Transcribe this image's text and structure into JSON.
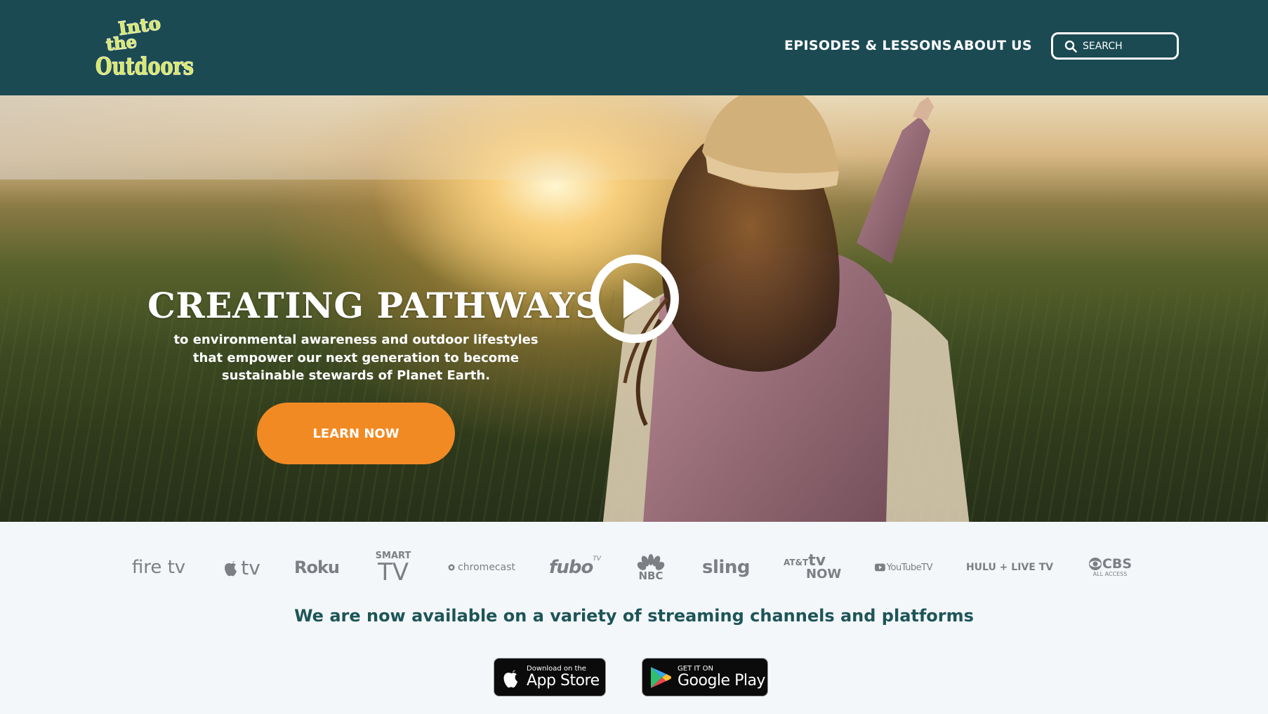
{
  "header": {
    "logo_text": [
      "Into",
      "the",
      "Outdoors"
    ],
    "nav": [
      {
        "label": "EPISODES & LESSONS"
      },
      {
        "label": "ABOUT US"
      }
    ],
    "search": {
      "placeholder": "SEARCH",
      "icon": "search-icon"
    }
  },
  "hero": {
    "title": "CREATING PATHWAYS",
    "subtitle": "to environmental awareness and outdoor lifestyles that empower our next generation to become sustainable stewards of Planet Earth.",
    "cta_label": "LEARN NOW",
    "play_icon": "play-icon"
  },
  "platforms": {
    "logos": [
      {
        "name": "fire tv",
        "text": "fire tv"
      },
      {
        "name": "apple tv",
        "text": "tv"
      },
      {
        "name": "roku",
        "text": "Roku"
      },
      {
        "name": "smart tv",
        "text_top": "SMART",
        "text_bottom": "TV"
      },
      {
        "name": "chromecast",
        "text": "chromecast"
      },
      {
        "name": "fubo",
        "text": "fubo",
        "sup": "TV"
      },
      {
        "name": "nbc",
        "text": "NBC"
      },
      {
        "name": "sling",
        "text": "sling"
      },
      {
        "name": "att tv now",
        "text_top": "AT&T",
        "text_tv": "tv",
        "text_bottom": "NOW"
      },
      {
        "name": "youtube tv",
        "text": "YouTubeTV"
      },
      {
        "name": "hulu live tv",
        "text": "HULU + LIVE TV"
      },
      {
        "name": "cbs all access",
        "text_top": "CBS",
        "text_bottom": "ALL ACCESS"
      }
    ],
    "headline": "We are now available on a variety of streaming channels and platforms",
    "app_store": {
      "small": "Download on the",
      "big": "App Store"
    },
    "google_play": {
      "small": "GET IT ON",
      "big": "Google Play"
    }
  },
  "colors": {
    "header_bg": "#1b4a53",
    "accent_orange": "#f28a24",
    "logo_green": "#b5cf3a",
    "headline_teal": "#1d5559"
  }
}
